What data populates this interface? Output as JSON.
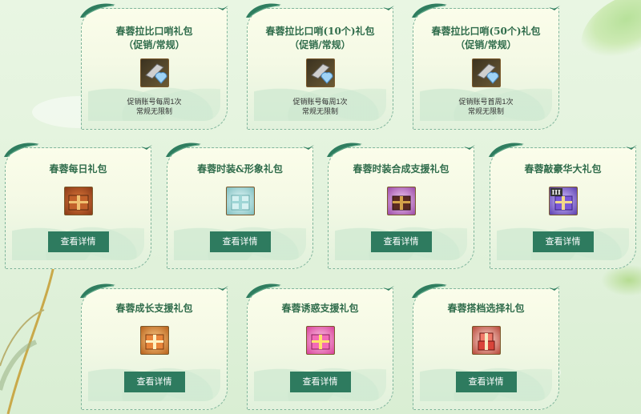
{
  "colors": {
    "accent": "#2e7b5f",
    "title": "#2f6c4b",
    "card_border": "#7fb59b"
  },
  "row1": [
    {
      "title_line1": "春蓉拉比口哨礼包",
      "title_line2": "（促销/常规）",
      "icon": "whistle-heart-icon",
      "note_line1": "促销账号每周1次",
      "note_line2": "常规无限制"
    },
    {
      "title_line1": "春蓉拉比口哨(10个)礼包",
      "title_line2": "（促销/常规）",
      "icon": "whistle-heart-icon",
      "note_line1": "促销账号每周1次",
      "note_line2": "常规无限制"
    },
    {
      "title_line1": "春蓉拉比口哨(50个)礼包",
      "title_line2": "（促销/常规）",
      "icon": "whistle-heart-icon",
      "note_line1": "促销账号首周1次",
      "note_line2": "常规无限制"
    }
  ],
  "row2": [
    {
      "title": "春蓉每日礼包",
      "icon": "brown-gift-box-icon",
      "button": "查看详情"
    },
    {
      "title": "春蓉时装&形象礼包",
      "icon": "silver-gift-box-icon",
      "button": "查看详情"
    },
    {
      "title": "春蓉时装合成支援礼包",
      "icon": "purple-gift-box-icon",
      "button": "查看详情"
    },
    {
      "title": "春蓉敲豪华大礼包",
      "icon": "violet-gift-box-icon",
      "badge": "III",
      "button": "查看详情"
    }
  ],
  "row3": [
    {
      "title": "春蓉成长支援礼包",
      "icon": "orange-gift-box-icon",
      "button": "查看详情"
    },
    {
      "title": "春蓉诱惑支援礼包",
      "icon": "pink-gift-box-icon",
      "button": "查看详情"
    },
    {
      "title": "春蓉搭档选择礼包",
      "icon": "red-gift-stack-icon",
      "button": "查看详情"
    }
  ]
}
